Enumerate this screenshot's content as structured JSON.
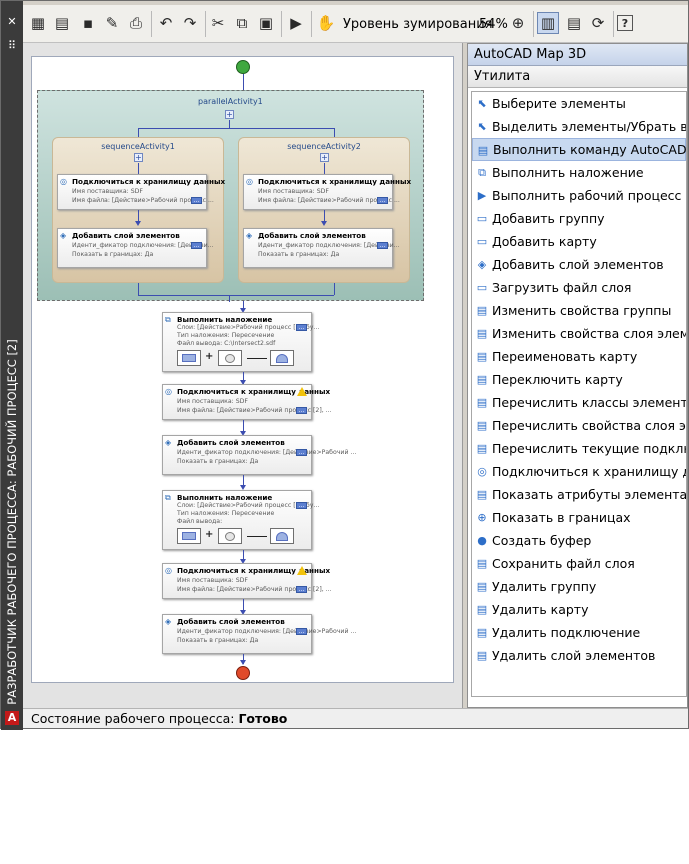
{
  "side_title": "РАЗРАБОТЧИК РАБОЧЕГО ПРОЦЕССА: РАБОЧИЙ ПРОЦЕСС [2]",
  "side_controls": {
    "close": "✕",
    "menu": "⠿"
  },
  "app_logo": "A",
  "toolbar": {
    "zoom_label": "Уровень зумирования",
    "zoom_value": "54%",
    "icons": [
      "new-workflow-icon",
      "open-workflow-icon",
      "save-icon",
      "save-as-icon",
      "print-icon",
      "undo-icon",
      "redo-icon",
      "cut-icon",
      "copy-icon",
      "paste-icon",
      "run-workflow-icon",
      "pan-icon",
      "zoom-icon",
      "toggle-panel-icon",
      "layout-icon",
      "refresh-icon",
      "help-icon"
    ]
  },
  "workflow": {
    "parallel_title": "parallelActivity1",
    "seq1_title": "sequenceActivity1",
    "seq2_title": "sequenceActivity2",
    "connect_title": "Подключиться к хранилищу данных",
    "connect_provider": "Имя поставщика:  SDF",
    "connect_file_a": "Имя файла:  [Действие>Рабочий процесс ...",
    "connect_file_b": "Имя файла:  [Действие>Рабочий процесс [2], ...",
    "add_layer_title": "Добавить слой элементов",
    "add_layer_conn": "Иденти_фикатор подключения:  [Действи...",
    "add_layer_conn_b": "Иденти_фикатор подключения:  [Действие>Рабочий ...",
    "add_layer_show": "Показать в границах:  Да",
    "overlay_title": "Выполнить наложение",
    "overlay_layers": "Слои:  [Действие>Рабочий процесс [2], бу...",
    "overlay_type": "Тип наложения:  Пересечение",
    "overlay_file": "Файл вывода:  C:\\Intersect2.sdf",
    "overlay_file_empty": "Файл вывода:"
  },
  "panel": {
    "title": "AutoCAD Map 3D",
    "category": "Утилита",
    "items": [
      {
        "label": "Выберите элементы",
        "icon": "select-features-icon"
      },
      {
        "label": "Выделить элементы/Убрать выделение",
        "icon": "select-toggle-icon"
      },
      {
        "label": "Выполнить команду AutoCAD",
        "icon": "run-command-icon",
        "selected": true
      },
      {
        "label": "Выполнить наложение",
        "icon": "overlay-icon"
      },
      {
        "label": "Выполнить рабочий процесс",
        "icon": "run-workflow-icon"
      },
      {
        "label": "Добавить группу",
        "icon": "add-group-icon"
      },
      {
        "label": "Добавить карту",
        "icon": "add-map-icon"
      },
      {
        "label": "Добавить слой элементов",
        "icon": "add-layer-icon"
      },
      {
        "label": "Загрузить файл слоя",
        "icon": "load-layer-icon"
      },
      {
        "label": "Изменить свойства группы",
        "icon": "edit-group-icon"
      },
      {
        "label": "Изменить свойства слоя элементов",
        "icon": "edit-layer-icon"
      },
      {
        "label": "Переименовать карту",
        "icon": "rename-map-icon"
      },
      {
        "label": "Переключить карту",
        "icon": "switch-map-icon"
      },
      {
        "label": "Перечислить классы элементов",
        "icon": "list-classes-icon"
      },
      {
        "label": "Перечислить свойства слоя элементов",
        "icon": "list-layer-props-icon"
      },
      {
        "label": "Перечислить текущие подключения",
        "icon": "list-connections-icon"
      },
      {
        "label": "Подключиться к хранилищу данных",
        "icon": "connect-store-icon"
      },
      {
        "label": "Показать атрибуты элемента",
        "icon": "show-attributes-icon"
      },
      {
        "label": "Показать в границах",
        "icon": "zoom-extents-icon"
      },
      {
        "label": "Создать буфер",
        "icon": "buffer-icon"
      },
      {
        "label": "Сохранить файл слоя",
        "icon": "save-layer-icon"
      },
      {
        "label": "Удалить группу",
        "icon": "delete-group-icon"
      },
      {
        "label": "Удалить карту",
        "icon": "delete-map-icon"
      },
      {
        "label": "Удалить подключение",
        "icon": "delete-connection-icon"
      },
      {
        "label": "Удалить слой элементов",
        "icon": "delete-layer-icon"
      }
    ]
  },
  "status": {
    "label": "Состояние рабочего процесса:",
    "value": "Готово"
  }
}
